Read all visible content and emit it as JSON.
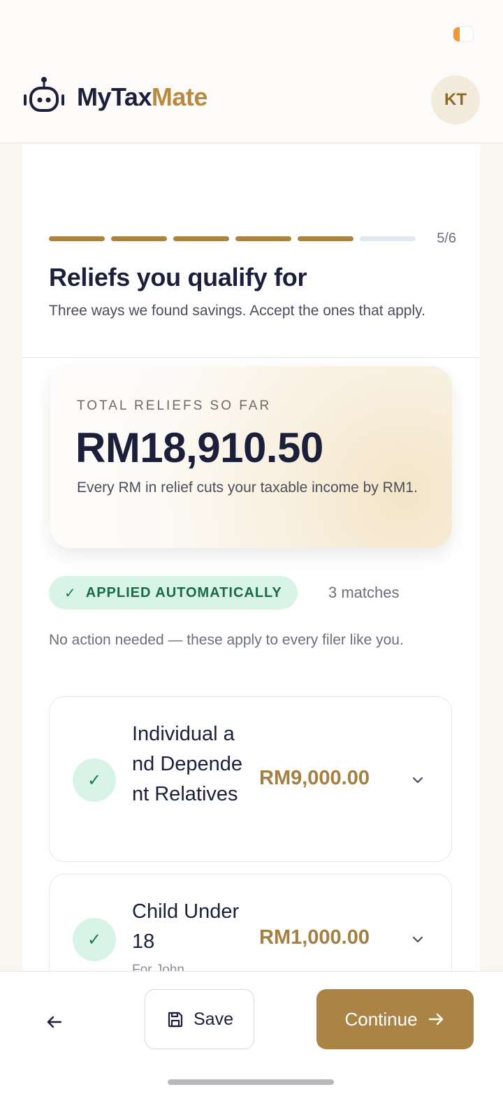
{
  "header": {
    "logo_part1": "MyTax",
    "logo_part2": "Mate",
    "avatar_initials": "KT"
  },
  "progress": {
    "current_step": 5,
    "total_steps": 6,
    "label": "5/6"
  },
  "page": {
    "title": "Reliefs you qualify for",
    "subtitle": "Three ways we found savings. Accept the ones that apply."
  },
  "total": {
    "label": "TOTAL RELIEFS SO FAR",
    "amount": "RM18,910.50",
    "description": "Every RM in relief cuts your taxable income by RM1."
  },
  "applied": {
    "badge_label": "APPLIED AUTOMATICALLY",
    "match_count": "3 matches",
    "note": "No action needed — these apply to every filer like you."
  },
  "reliefs": [
    {
      "name": "Individual and Dependent Relatives",
      "amount": "RM9,000.00",
      "subtitle": ""
    },
    {
      "name": "Child Under 18",
      "amount": "RM1,000.00",
      "subtitle": "For John"
    }
  ],
  "footer": {
    "save_label": "Save",
    "continue_label": "Continue"
  },
  "colors": {
    "accent_gold": "#a98445",
    "applied_green": "#d8f4e6",
    "text_navy": "#1c1f3a"
  },
  "icons": {
    "logo": "robot-icon",
    "back": "arrow-left-icon",
    "save": "floppy-disk-icon",
    "continue": "arrow-right-icon",
    "check": "check-icon",
    "expand": "chevron-down-icon"
  }
}
